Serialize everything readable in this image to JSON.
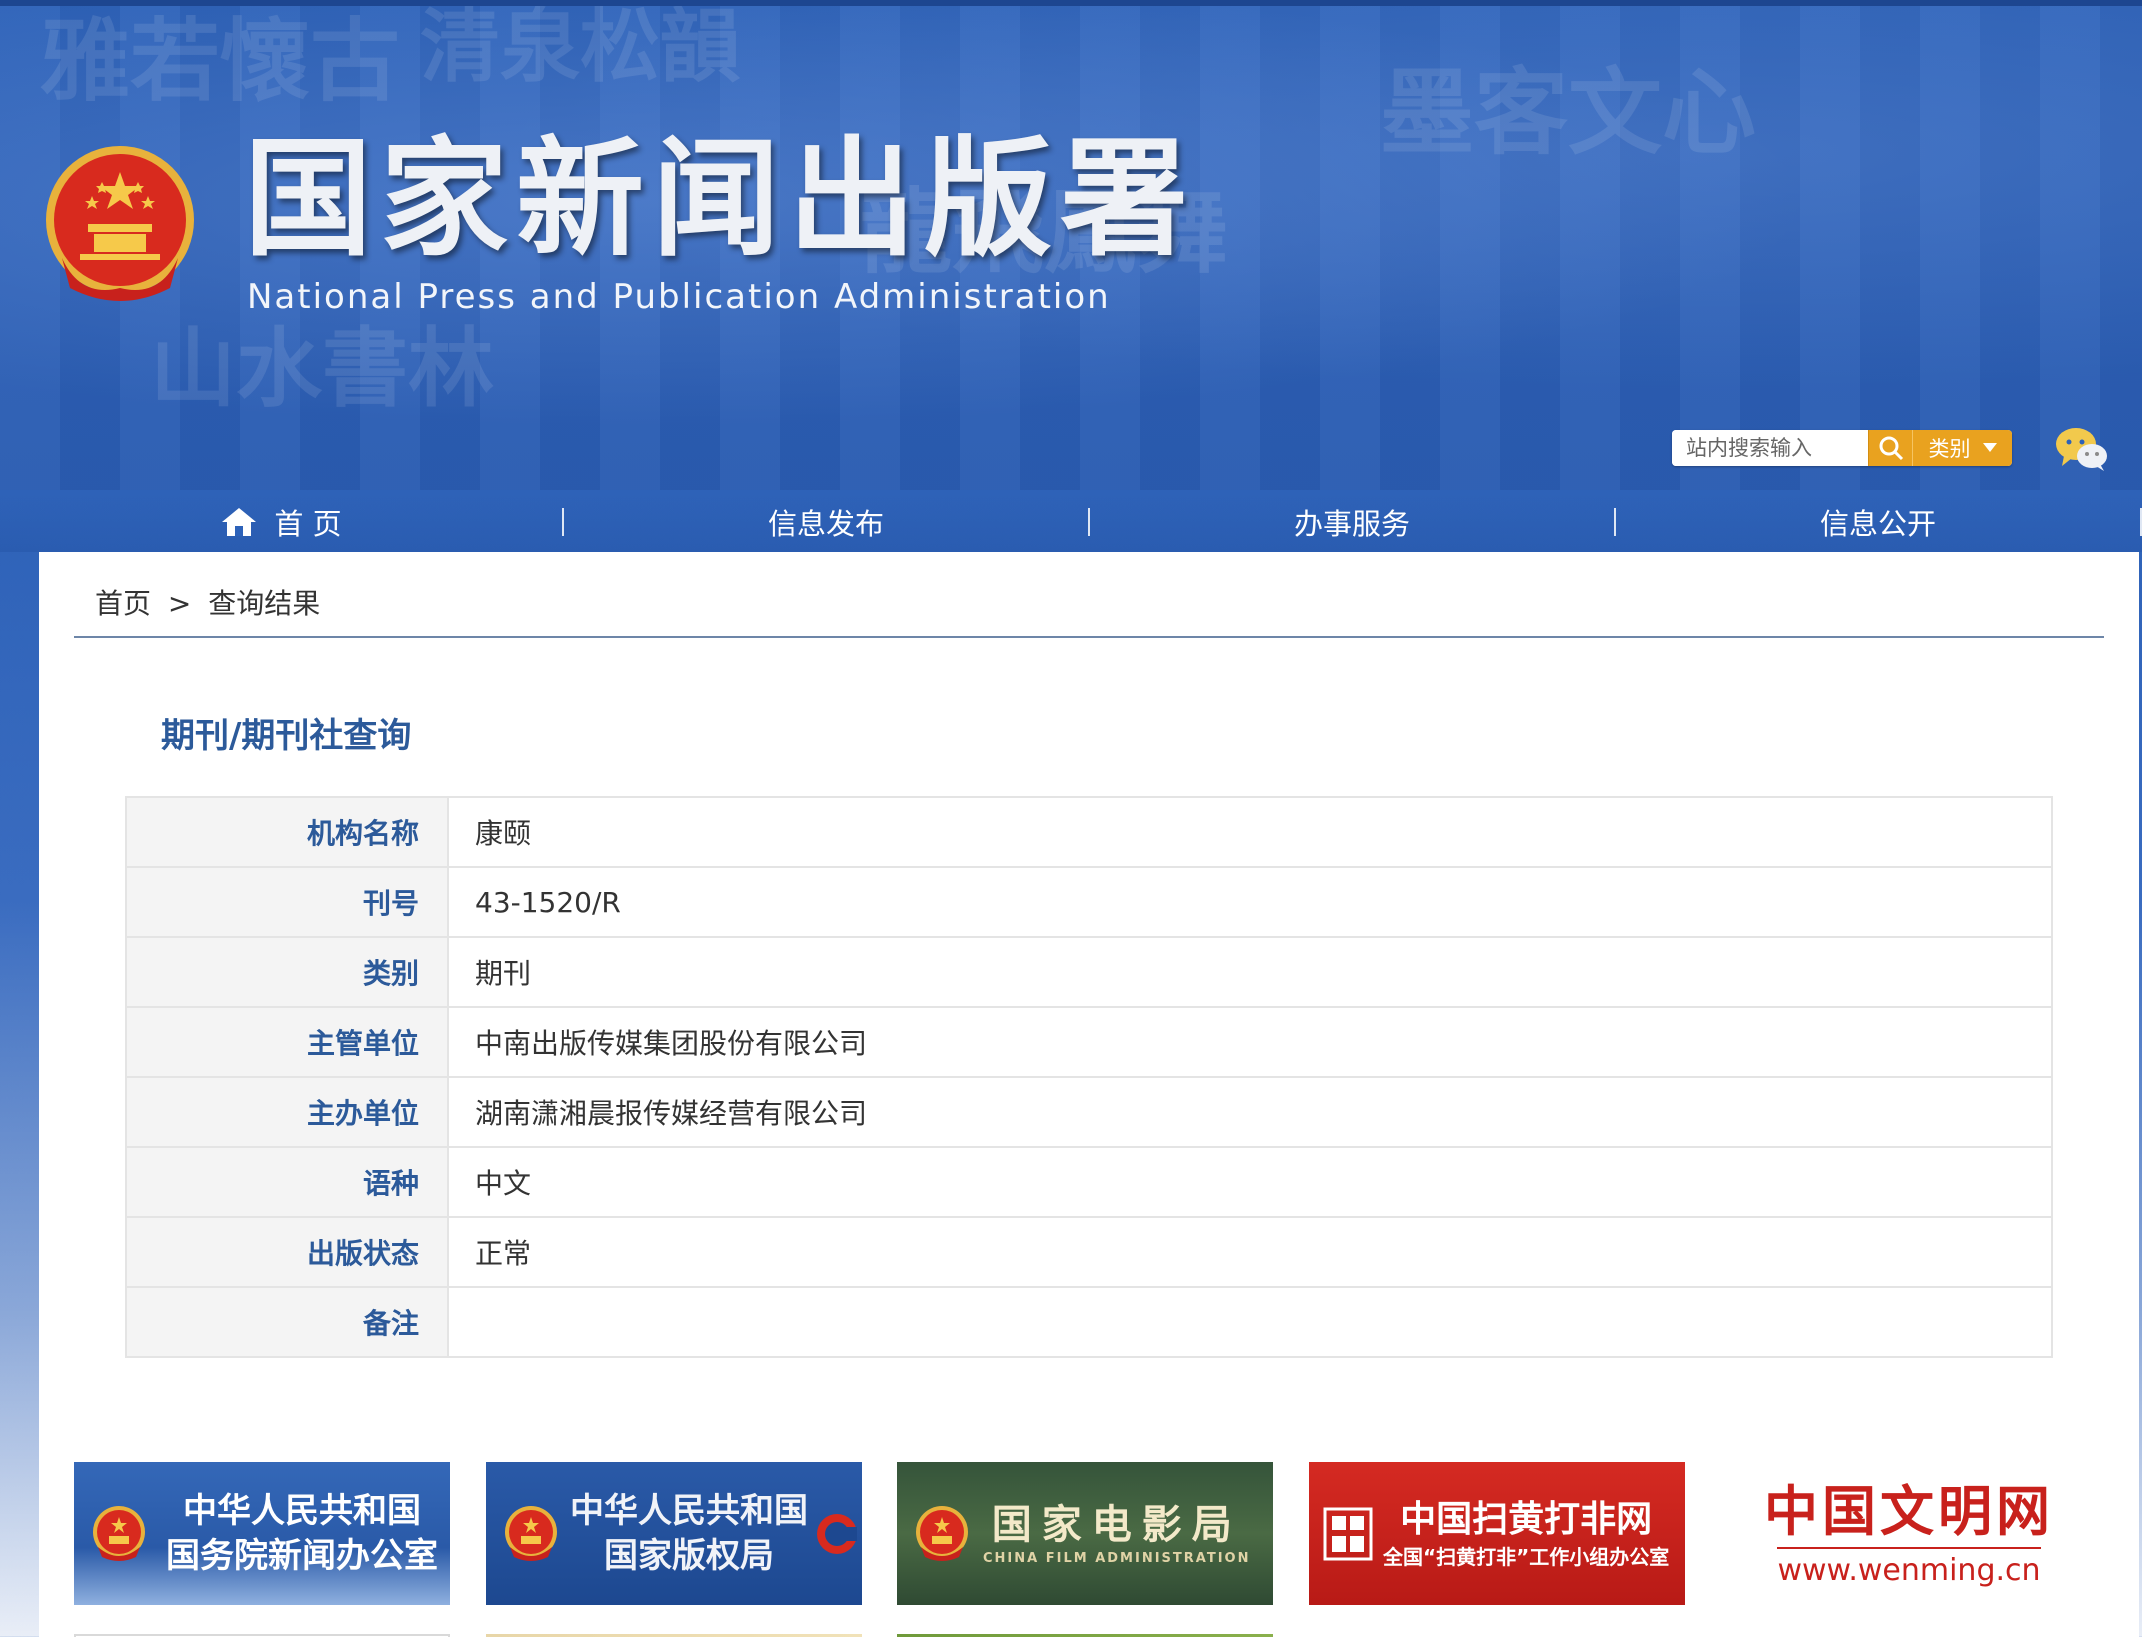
{
  "header": {
    "title": "国家新闻出版署",
    "subtitle": "National Press and Publication Administration",
    "calligraphy": [
      "雅若懷古",
      "清泉松韻",
      "山水書林",
      "龍飛鳳舞",
      "墨客文心"
    ]
  },
  "search": {
    "placeholder": "站内搜索输入",
    "category_label": "类别"
  },
  "nav": {
    "items": [
      {
        "label": "首 页"
      },
      {
        "label": "信息发布"
      },
      {
        "label": "办事服务"
      },
      {
        "label": "信息公开"
      }
    ]
  },
  "breadcrumb": {
    "home": "首页",
    "separator": ">",
    "current": "查询结果"
  },
  "page_title": "期刊/期刊社查询",
  "record": [
    {
      "label": "机构名称",
      "value": "康颐"
    },
    {
      "label": "刊号",
      "value": "43-1520/R"
    },
    {
      "label": "类别",
      "value": "期刊"
    },
    {
      "label": "主管单位",
      "value": "中南出版传媒集团股份有限公司"
    },
    {
      "label": "主办单位",
      "value": "湖南潇湘晨报传媒经营有限公司"
    },
    {
      "label": "语种",
      "value": "中文"
    },
    {
      "label": "出版状态",
      "value": "正常"
    },
    {
      "label": "备注",
      "value": ""
    }
  ],
  "links": {
    "scio": {
      "line1": "中华人民共和国",
      "line2": "国务院新闻办公室"
    },
    "ncac": {
      "line1": "中华人民共和国",
      "line2": "国家版权局"
    },
    "film": {
      "line1": "国家电影局",
      "line2": "CHINA FILM ADMINISTRATION"
    },
    "shdf": {
      "line1": "中国扫黄打非网",
      "line2": "全国“扫黄打非”工作小组办公室"
    },
    "wenming": {
      "line1": "中国文明网",
      "line2": "www.wenming.cn"
    }
  },
  "colors": {
    "header_blue": "#2d62b9",
    "accent_orange": "#e9a21f",
    "label_blue": "#2c5a9a",
    "card_scio": "#2a5eae",
    "card_ncac": "#1f4c96",
    "card_film": "#3e5c3a",
    "card_shdf": "#c8211c",
    "wenming_red": "#c8211c"
  }
}
